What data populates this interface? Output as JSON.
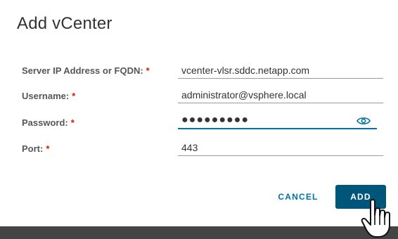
{
  "dialog": {
    "title": "Add vCenter"
  },
  "form": {
    "server": {
      "label": "Server IP Address or FQDN:",
      "required_mark": "*",
      "value": "vcenter-vlsr.sddc.netapp.com"
    },
    "username": {
      "label": "Username:",
      "required_mark": "*",
      "value": "administrator@vsphere.local"
    },
    "password": {
      "label": "Password:",
      "required_mark": "*",
      "value": "●●●●●●●●●",
      "icon": "eye-icon"
    },
    "port": {
      "label": "Port:",
      "required_mark": "*",
      "value": "443"
    }
  },
  "actions": {
    "cancel_label": "CANCEL",
    "add_label": "ADD"
  },
  "colors": {
    "accent": "#0072a3",
    "primary_button": "#00567a",
    "required": "#c92100"
  }
}
